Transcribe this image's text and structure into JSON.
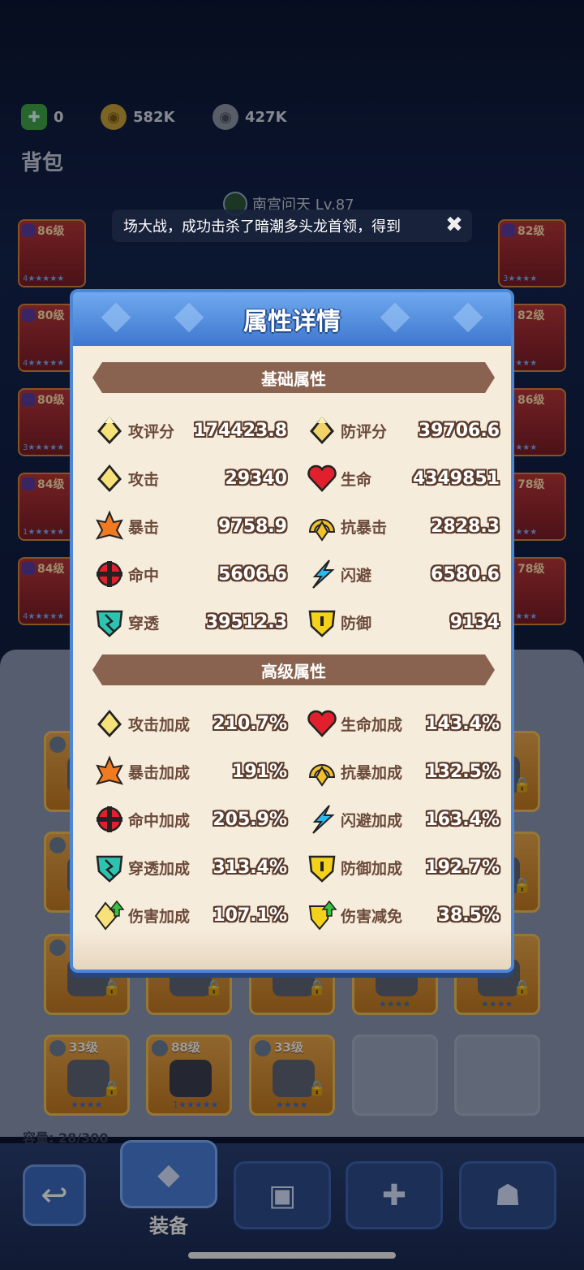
{
  "currencies": [
    {
      "name": "gem",
      "value": "0",
      "icon": "green-gem-plus-icon",
      "color": "#3fa64a"
    },
    {
      "name": "gold",
      "value": "582K",
      "icon": "gold-coin-icon",
      "color": "#c9a23a"
    },
    {
      "name": "silver",
      "value": "427K",
      "icon": "silver-coin-icon",
      "color": "#8e96a8"
    }
  ],
  "bag_title": "背包",
  "player_name": "南宫问天 Lv.87",
  "toast_text": "场大战，成功击杀了暗潮多头龙首领，得到",
  "side_cards_left": [
    {
      "level": "86级",
      "count": "4"
    },
    {
      "level": "80级",
      "count": "4"
    },
    {
      "level": "80级",
      "count": "3"
    },
    {
      "level": "84级",
      "count": "1"
    },
    {
      "level": "84级",
      "count": "4"
    }
  ],
  "side_cards_right": [
    {
      "level": "82级",
      "count": "3"
    },
    {
      "level": "82级",
      "count": "3"
    },
    {
      "level": "86级",
      "count": "3"
    },
    {
      "level": "78级",
      "count": "2"
    },
    {
      "level": "78级",
      "count": "5"
    }
  ],
  "modal": {
    "title": "属性详情",
    "basic_title": "基础属性",
    "advanced_title": "高级属性",
    "basic_stats": [
      {
        "label": "攻评分",
        "value": "174423.8",
        "icon": "attack-rating-icon"
      },
      {
        "label": "防评分",
        "value": "39706.6",
        "icon": "defense-rating-icon"
      },
      {
        "label": "攻击",
        "value": "29340",
        "icon": "attack-icon"
      },
      {
        "label": "生命",
        "value": "4349851",
        "icon": "heart-icon"
      },
      {
        "label": "暴击",
        "value": "9758.9",
        "icon": "crit-icon"
      },
      {
        "label": "抗暴击",
        "value": "2828.3",
        "icon": "crit-resist-icon"
      },
      {
        "label": "命中",
        "value": "5606.6",
        "icon": "accuracy-icon"
      },
      {
        "label": "闪避",
        "value": "6580.6",
        "icon": "dodge-icon"
      },
      {
        "label": "穿透",
        "value": "39512.3",
        "icon": "penetration-icon"
      },
      {
        "label": "防御",
        "value": "9134",
        "icon": "defense-icon"
      }
    ],
    "advanced_stats": [
      {
        "label": "攻击加成",
        "value": "210.7%",
        "icon": "attack-icon"
      },
      {
        "label": "生命加成",
        "value": "143.4%",
        "icon": "heart-icon"
      },
      {
        "label": "暴击加成",
        "value": "191%",
        "icon": "crit-icon"
      },
      {
        "label": "抗暴加成",
        "value": "132.5%",
        "icon": "crit-resist-icon"
      },
      {
        "label": "命中加成",
        "value": "205.9%",
        "icon": "accuracy-icon"
      },
      {
        "label": "闪避加成",
        "value": "163.4%",
        "icon": "dodge-icon"
      },
      {
        "label": "穿透加成",
        "value": "313.4%",
        "icon": "penetration-icon"
      },
      {
        "label": "防御加成",
        "value": "192.7%",
        "icon": "defense-icon"
      },
      {
        "label": "伤害加成",
        "value": "107.1%",
        "icon": "damage-bonus-icon"
      },
      {
        "label": "伤害减免",
        "value": "38.5%",
        "icon": "damage-reduction-icon"
      }
    ]
  },
  "inventory_bottom_row": [
    {
      "level": "33级"
    },
    {
      "level": "88级",
      "count": "1"
    },
    {
      "level": "33级"
    }
  ],
  "capacity": "容量: 28/300",
  "nav": {
    "active_label": "装备"
  }
}
